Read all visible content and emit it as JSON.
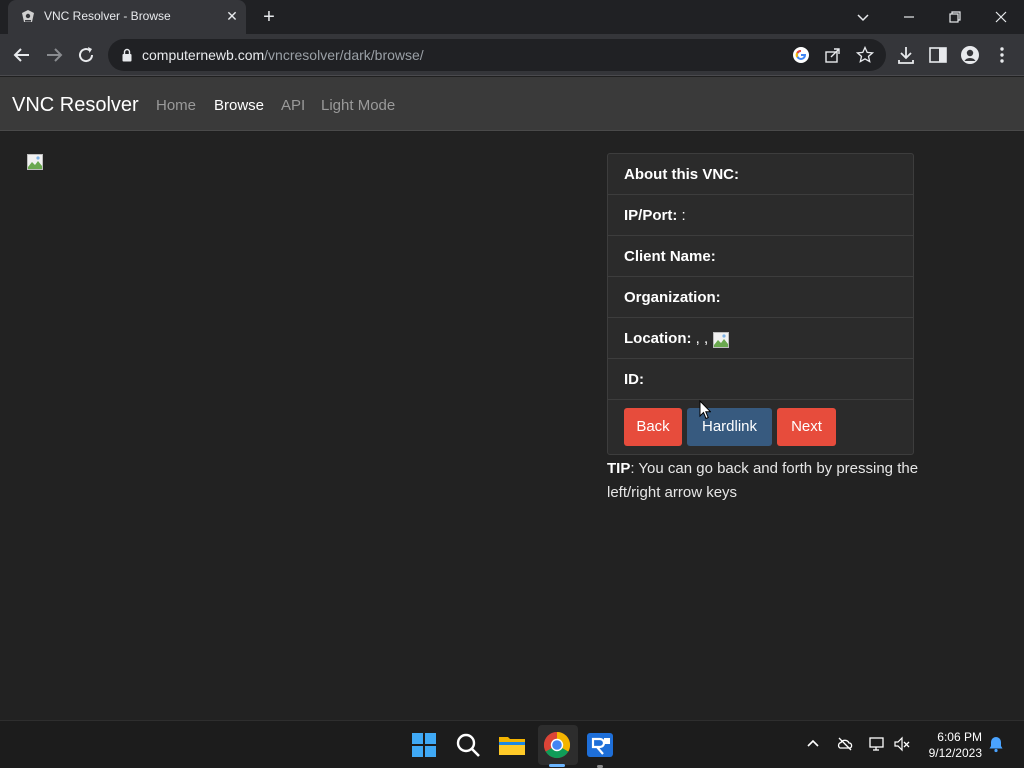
{
  "browser": {
    "tab_title": "VNC Resolver - Browse",
    "url_host": "computernewb.com",
    "url_path": "/vncresolver/dark/browse/"
  },
  "site": {
    "brand": "VNC Resolver",
    "nav": {
      "home": "Home",
      "browse": "Browse",
      "api": "API",
      "light_mode": "Light Mode"
    }
  },
  "info": {
    "about_label": "About this VNC:",
    "ip_label": "IP/Port:",
    "ip_value": " :",
    "client_label": "Client Name:",
    "org_label": "Organization:",
    "location_label": "Location:",
    "location_value": " , ,",
    "id_label": "ID:"
  },
  "buttons": {
    "back": "Back",
    "hardlink": "Hardlink",
    "next": "Next"
  },
  "tip": {
    "label": "TIP",
    "text": ": You can go back and forth by pressing the left/right arrow keys"
  },
  "taskbar": {
    "time": "6:06 PM",
    "date": "9/12/2023"
  },
  "icons": {
    "back": "arrow-left-icon",
    "forward": "arrow-right-icon",
    "reload": "reload-icon",
    "google": "google-icon",
    "share": "share-icon",
    "bookmark": "star-icon",
    "download": "download-icon",
    "sidepanel": "side-panel-icon",
    "profile": "profile-icon",
    "menu": "kebab-menu-icon"
  },
  "colors": {
    "danger": "#e74c3c",
    "primary": "#375a7f",
    "background": "#222222",
    "navbar": "#3a3a3a"
  }
}
